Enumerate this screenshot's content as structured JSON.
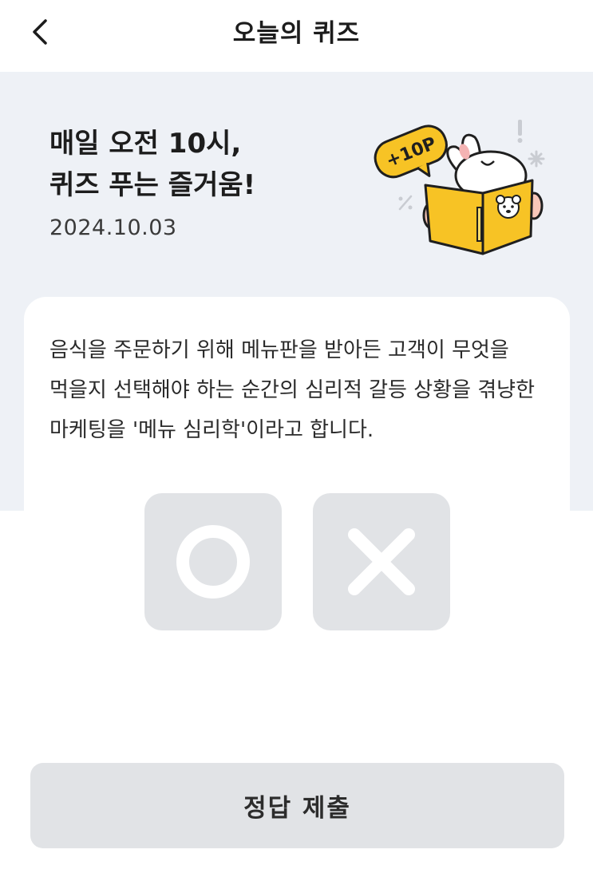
{
  "header": {
    "back_icon": "chevron-left-icon",
    "title": "오늘의 퀴즈"
  },
  "hero": {
    "title_line1": "매일 오전 10시,",
    "title_line2": "퀴즈 푸는 즐거움!",
    "date": "2024.10.03",
    "badge_text": "+10P",
    "illustration": "rabbit-reading-book-illustration"
  },
  "quiz": {
    "question": "음식을 주문하기 위해 메뉴판을 받아든 고객이 무엇을 먹을지 선택해야 하는 순간의 심리적 갈등 상황을 겪냥한 마케팅을 '메뉴 심리학'이라고 합니다.",
    "option_o_icon": "circle-o-icon",
    "option_x_icon": "cross-x-icon"
  },
  "submit": {
    "label": "정답 제출"
  },
  "colors": {
    "hero_bg": "#eef1f6",
    "button_bg": "#e1e3e6",
    "accent_yellow": "#f7c325"
  }
}
